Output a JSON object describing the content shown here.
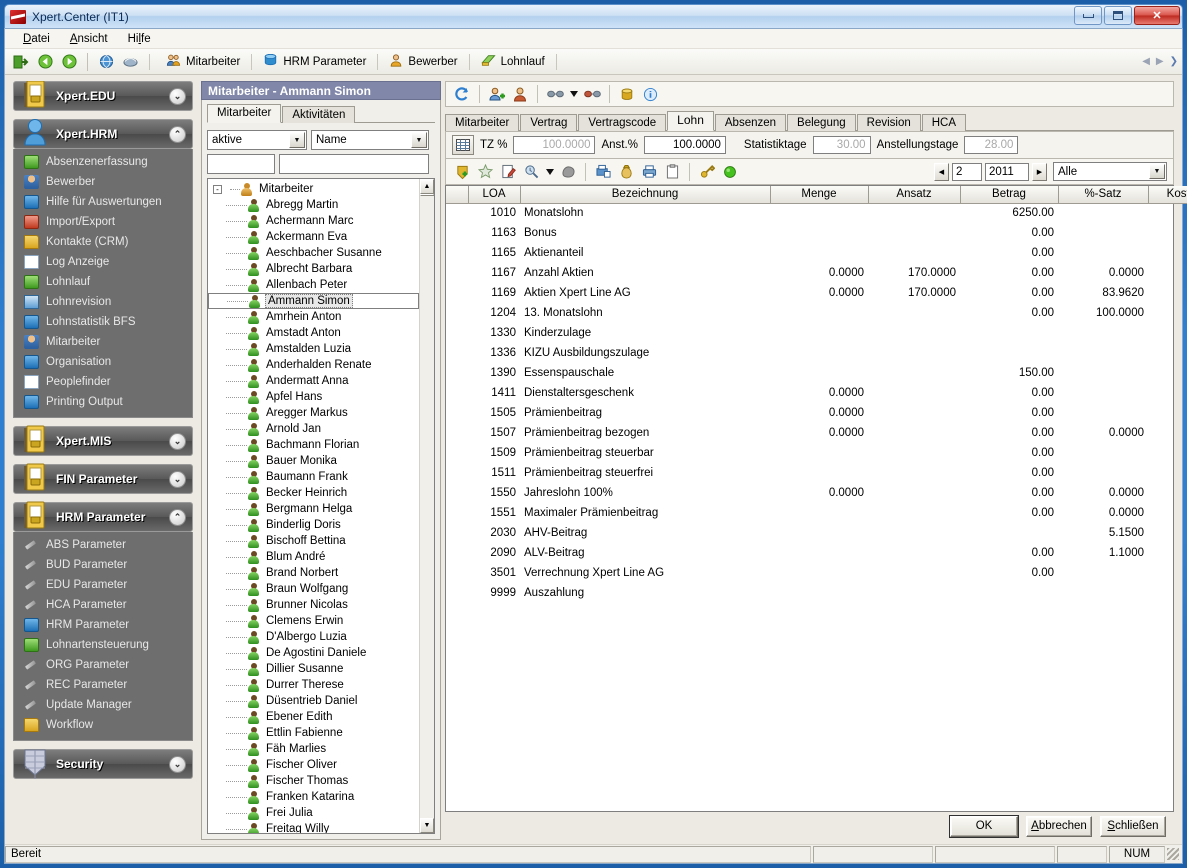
{
  "window": {
    "title": "Xpert.Center (IT1)",
    "app_icon": "xpert-logo-icon",
    "minimize": "minimize-icon",
    "maximize": "maximize-icon",
    "close": "close-icon"
  },
  "menubar": [
    {
      "label": "Datei",
      "accel": "D"
    },
    {
      "label": "Ansicht",
      "accel": "A"
    },
    {
      "label": "Hilfe",
      "accel": "l"
    }
  ],
  "toolbar": {
    "icons": [
      "exit-door-icon",
      "back-arrow-icon",
      "forward-arrow-icon",
      "globe-icon",
      "print-preview-icon"
    ],
    "modules": [
      {
        "label": "Mitarbeiter",
        "icon": "users-icon"
      },
      {
        "label": "HRM Parameter",
        "icon": "database-icon"
      },
      {
        "label": "Bewerber",
        "icon": "applicant-icon"
      },
      {
        "label": "Lohnlauf",
        "icon": "payroll-icon"
      }
    ],
    "scroll_left": "scroll-left-icon",
    "scroll_right": "scroll-right-icon"
  },
  "sidebar": {
    "groups": [
      {
        "title": "Xpert.EDU",
        "icon": "binder-icon",
        "expanded": false,
        "chevron": "chevron-down-icon",
        "items": []
      },
      {
        "title": "Xpert.HRM",
        "icon": "person-blue-icon",
        "expanded": true,
        "chevron": "chevron-up-icon",
        "items": [
          {
            "label": "Absenzenerfassung",
            "icon": "absence-icon"
          },
          {
            "label": "Bewerber",
            "icon": "applicant-icon"
          },
          {
            "label": "Hilfe für Auswertungen",
            "icon": "database-icon"
          },
          {
            "label": "Import/Export",
            "icon": "import-export-icon"
          },
          {
            "label": "Kontakte (CRM)",
            "icon": "contacts-icon"
          },
          {
            "label": "Log Anzeige",
            "icon": "log-icon"
          },
          {
            "label": "Lohnlauf",
            "icon": "payroll-icon"
          },
          {
            "label": "Lohnrevision",
            "icon": "revision-icon"
          },
          {
            "label": "Lohnstatistik BFS",
            "icon": "statistics-icon"
          },
          {
            "label": "Mitarbeiter",
            "icon": "users-icon"
          },
          {
            "label": "Organisation",
            "icon": "organisation-icon"
          },
          {
            "label": "Peoplefinder",
            "icon": "peoplefinder-icon"
          },
          {
            "label": "Printing Output",
            "icon": "printer-icon"
          }
        ]
      },
      {
        "title": "Xpert.MIS",
        "icon": "binder-icon",
        "expanded": false,
        "chevron": "chevron-down-icon",
        "items": []
      },
      {
        "title": "FIN Parameter",
        "icon": "binder-icon",
        "expanded": false,
        "chevron": "chevron-down-icon",
        "items": []
      },
      {
        "title": "HRM Parameter",
        "icon": "binder-icon",
        "expanded": true,
        "chevron": "chevron-up-icon",
        "items": [
          {
            "label": "ABS Parameter",
            "icon": "wrench-icon"
          },
          {
            "label": "BUD Parameter",
            "icon": "wrench-icon"
          },
          {
            "label": "EDU Parameter",
            "icon": "wrench-icon"
          },
          {
            "label": "HCA Parameter",
            "icon": "wrench-icon"
          },
          {
            "label": "HRM Parameter",
            "icon": "database-icon"
          },
          {
            "label": "Lohnartensteuerung",
            "icon": "absence-icon"
          },
          {
            "label": "ORG Parameter",
            "icon": "wrench-icon"
          },
          {
            "label": "REC Parameter",
            "icon": "wrench-icon"
          },
          {
            "label": "Update Manager",
            "icon": "wrench-icon"
          },
          {
            "label": "Workflow",
            "icon": "workflow-icon"
          }
        ]
      },
      {
        "title": "Security",
        "icon": "shield-icon",
        "expanded": false,
        "chevron": "chevron-down-icon",
        "items": []
      }
    ]
  },
  "tree_panel": {
    "header": "Mitarbeiter - Ammann Simon",
    "tabs": [
      {
        "label": "Mitarbeiter",
        "active": true
      },
      {
        "label": "Aktivitäten",
        "active": false
      }
    ],
    "filter_status": {
      "value": "aktive",
      "arrow": "chevron-down-icon"
    },
    "filter_sort": {
      "value": "Name",
      "arrow": "chevron-down-icon"
    },
    "search_small": {
      "value": "",
      "placeholder": ""
    },
    "search_large": {
      "value": "",
      "placeholder": ""
    },
    "root": {
      "label": "Mitarbeiter",
      "expander": "-"
    },
    "selected": "Ammann Simon",
    "items": [
      "Abregg Martin",
      "Achermann Marc",
      "Ackermann Eva",
      "Aeschbacher Susanne",
      "Albrecht Barbara",
      "Allenbach Peter",
      "Ammann Simon",
      "Amrhein Anton",
      "Amstadt Anton",
      "Amstalden Luzia",
      "Anderhalden Renate",
      "Andermatt Anna",
      "Apfel Hans",
      "Aregger Markus",
      "Arnold Jan",
      "Bachmann Florian",
      "Bauer Monika",
      "Baumann Frank",
      "Becker Heinrich",
      "Bergmann Helga",
      "Binderlig Doris",
      "Bischoff Bettina",
      "Blum André",
      "Brand Norbert",
      "Braun Wolfgang",
      "Brunner Nicolas",
      "Clemens Erwin",
      "D'Albergo Luzia",
      "De Agostini Daniele",
      "Dillier Susanne",
      "Durrer Therese",
      "Düsentrieb Daniel",
      "Ebener Edith",
      "Ettlin Fabienne",
      "Fäh Marlies",
      "Fischer Oliver",
      "Fischer Thomas",
      "Franken Katarina",
      "Frei Julia",
      "Freitag Willy"
    ],
    "scroll_up": "scroll-up-icon",
    "scroll_down": "scroll-down-icon"
  },
  "main": {
    "toolbar_icons": [
      "refresh-icon",
      "add-user-icon",
      "edit-user-icon",
      "glasses-icon",
      "dropdown-arrow-icon",
      "glasses-red-icon",
      "database-icon",
      "info-icon"
    ],
    "tabs": [
      {
        "label": "Mitarbeiter",
        "active": false
      },
      {
        "label": "Vertrag",
        "active": false
      },
      {
        "label": "Vertragscode",
        "active": false
      },
      {
        "label": "Lohn",
        "active": true
      },
      {
        "label": "Absenzen",
        "active": false
      },
      {
        "label": "Belegung",
        "active": false
      },
      {
        "label": "Revision",
        "active": false
      },
      {
        "label": "HCA",
        "active": false
      }
    ],
    "fields": [
      {
        "name": "grid-settings-button",
        "icon": "grid-settings-icon"
      },
      {
        "label": "TZ %",
        "value": "100.0000",
        "readonly": true
      },
      {
        "label": "Anst.%",
        "value": "100.0000",
        "readonly": false
      },
      {
        "label": "Statistiktage",
        "value": "30.00",
        "readonly": true
      },
      {
        "label": "Anstellungstage",
        "value": "28.00",
        "readonly": true
      }
    ],
    "grid_toolbar_icons": [
      "add-shield-icon",
      "favorite-star-icon",
      "edit-note-icon",
      "search-clock-icon",
      "dropdown-arrow-icon",
      "stone-icon",
      "print-data-icon",
      "money-bag-icon",
      "printer-icon",
      "clipboard-icon",
      "key-icon",
      "status-green-icon"
    ],
    "period": {
      "prev": "prev-icon",
      "month": "2",
      "year": "2011",
      "next": "next-icon",
      "filter": {
        "value": "Alle",
        "arrow": "chevron-down-icon"
      }
    }
  },
  "grid": {
    "columns": [
      "",
      "LOA",
      "Bezeichnung",
      "Menge",
      "Ansatz",
      "Betrag",
      "%-Satz",
      "Kostenstelle",
      ""
    ],
    "rows": [
      {
        "icon": "shield-blue-icon",
        "selected": true,
        "loa": "1010",
        "bezeichnung": "Monatslohn",
        "menge": "",
        "ansatz": "",
        "betrag": "6250.00",
        "satz": "",
        "kostenstelle": ""
      },
      {
        "icon": "shield-gold-icon",
        "selected": false,
        "loa": "1163",
        "bezeichnung": "Bonus",
        "menge": "",
        "ansatz": "",
        "betrag": "0.00",
        "satz": "",
        "kostenstelle": ""
      },
      {
        "icon": "shield-gold-icon",
        "selected": false,
        "loa": "1165",
        "bezeichnung": "Aktienanteil",
        "menge": "",
        "ansatz": "",
        "betrag": "0.00",
        "satz": "",
        "kostenstelle": ""
      },
      {
        "icon": "shield-gold-icon",
        "selected": false,
        "loa": "1167",
        "bezeichnung": "Anzahl Aktien",
        "menge": "0.0000",
        "ansatz": "170.0000",
        "betrag": "0.00",
        "satz": "0.0000",
        "kostenstelle": ""
      },
      {
        "icon": "shield-gold-icon",
        "selected": false,
        "loa": "1169",
        "bezeichnung": "Aktien Xpert Line AG",
        "menge": "0.0000",
        "ansatz": "170.0000",
        "betrag": "0.00",
        "satz": "83.9620",
        "kostenstelle": ""
      },
      {
        "icon": "shield-gold-icon",
        "selected": false,
        "loa": "1204",
        "bezeichnung": "13. Monatslohn",
        "menge": "",
        "ansatz": "",
        "betrag": "0.00",
        "satz": "100.0000",
        "kostenstelle": ""
      },
      {
        "icon": "shield-gold-icon",
        "selected": false,
        "loa": "1330",
        "bezeichnung": "Kinderzulage",
        "menge": "",
        "ansatz": "",
        "betrag": "",
        "satz": "",
        "kostenstelle": ""
      },
      {
        "icon": "shield-gold-icon",
        "selected": false,
        "loa": "1336",
        "bezeichnung": "KIZU Ausbildungszulage",
        "menge": "",
        "ansatz": "",
        "betrag": "",
        "satz": "",
        "kostenstelle": ""
      },
      {
        "icon": "shield-gold-icon",
        "selected": false,
        "loa": "1390",
        "bezeichnung": "Essenspauschale",
        "menge": "",
        "ansatz": "",
        "betrag": "150.00",
        "satz": "",
        "kostenstelle": ""
      },
      {
        "icon": "shield-gold-icon",
        "selected": false,
        "loa": "1411",
        "bezeichnung": "Dienstaltersgeschenk",
        "menge": "0.0000",
        "ansatz": "",
        "betrag": "0.00",
        "satz": "",
        "kostenstelle": ""
      },
      {
        "icon": "shield-gold-icon",
        "selected": false,
        "loa": "1505",
        "bezeichnung": "Prämienbeitrag",
        "menge": "0.0000",
        "ansatz": "",
        "betrag": "0.00",
        "satz": "",
        "kostenstelle": ""
      },
      {
        "icon": "shield-gold-icon",
        "selected": false,
        "loa": "1507",
        "bezeichnung": "Prämienbeitrag bezogen",
        "menge": "0.0000",
        "ansatz": "",
        "betrag": "0.00",
        "satz": "0.0000",
        "kostenstelle": ""
      },
      {
        "icon": "shield-gold-icon",
        "selected": false,
        "loa": "1509",
        "bezeichnung": "Prämienbeitrag steuerbar",
        "menge": "",
        "ansatz": "",
        "betrag": "0.00",
        "satz": "",
        "kostenstelle": ""
      },
      {
        "icon": "shield-gold-icon",
        "selected": false,
        "loa": "1511",
        "bezeichnung": "Prämienbeitrag steuerfrei",
        "menge": "",
        "ansatz": "",
        "betrag": "0.00",
        "satz": "",
        "kostenstelle": ""
      },
      {
        "icon": "shield-gold-icon",
        "selected": false,
        "loa": "1550",
        "bezeichnung": "Jahreslohn 100%",
        "menge": "0.0000",
        "ansatz": "",
        "betrag": "0.00",
        "satz": "0.0000",
        "kostenstelle": ""
      },
      {
        "icon": "shield-gold-icon",
        "selected": false,
        "loa": "1551",
        "bezeichnung": "Maximaler Prämienbeitrag",
        "menge": "",
        "ansatz": "",
        "betrag": "0.00",
        "satz": "0.0000",
        "kostenstelle": ""
      },
      {
        "icon": "shield-gold-icon",
        "selected": false,
        "loa": "2030",
        "bezeichnung": "AHV-Beitrag",
        "menge": "",
        "ansatz": "",
        "betrag": "",
        "satz": "5.1500",
        "kostenstelle": ""
      },
      {
        "icon": "shield-gold-icon",
        "selected": false,
        "loa": "2090",
        "bezeichnung": "ALV-Beitrag",
        "menge": "",
        "ansatz": "",
        "betrag": "0.00",
        "satz": "1.1000",
        "kostenstelle": ""
      },
      {
        "icon": "shield-gold-icon",
        "selected": false,
        "loa": "3501",
        "bezeichnung": "Verrechnung Xpert Line AG",
        "menge": "",
        "ansatz": "",
        "betrag": "0.00",
        "satz": "",
        "kostenstelle": ""
      },
      {
        "icon": "payout-icon",
        "selected": false,
        "loa": "9999",
        "bezeichnung": "Auszahlung",
        "menge": "",
        "ansatz": "",
        "betrag": "",
        "satz": "",
        "kostenstelle": ""
      }
    ]
  },
  "buttons": {
    "ok": "OK",
    "cancel": "Abbrechen",
    "close": "Schließen"
  },
  "statusbar": {
    "message": "Bereit",
    "cells": [
      "",
      "",
      ""
    ],
    "num": "NUM"
  },
  "colors": {
    "titlebar_blue": "#2f7fd0",
    "panel_header": "#8087a8",
    "sidebar_dark": "#6e6e6e",
    "accent_green": "#3f9a20"
  }
}
